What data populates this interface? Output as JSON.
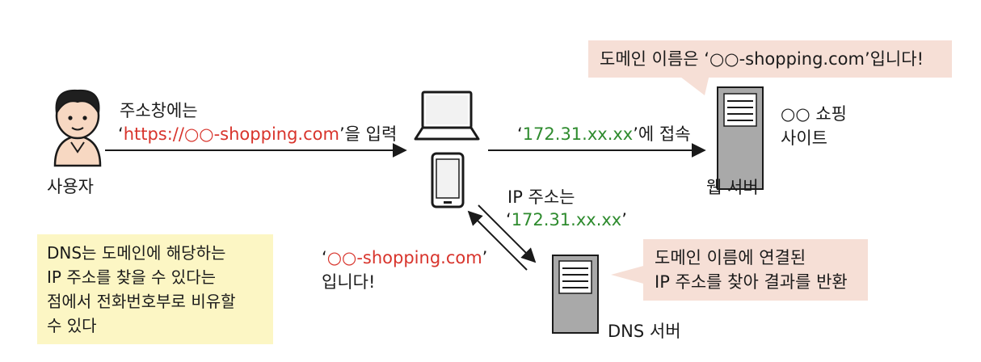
{
  "user": {
    "label": "사용자",
    "icon": "person-icon"
  },
  "request": {
    "line1": "주소창에는",
    "quote_open": "‘",
    "url": "https://○○-shopping.com",
    "quote_close": "’을 입력"
  },
  "devices": {
    "laptop_icon": "laptop-icon",
    "phone_icon": "smartphone-icon"
  },
  "connect": {
    "quote_open": "‘",
    "ip": "172.31.xx.xx",
    "quote_close": "’에 접속"
  },
  "web_server": {
    "label": "웹 서버",
    "site_line1": "○○ 쇼핑",
    "site_line2": "사이트",
    "bubble_prefix": "도메인 이름은 ‘",
    "bubble_domain": "○○-shopping.com",
    "bubble_suffix": "’입니다!",
    "icon": "server-icon"
  },
  "dns_reply": {
    "line1": "IP 주소는",
    "quote_open": "‘",
    "ip": "172.31.xx.xx",
    "quote_close": "’"
  },
  "dns_query": {
    "quote_open": "‘",
    "domain": "○○-shopping.com",
    "quote_close": "’",
    "line2": "입니다!"
  },
  "dns_server": {
    "label": "DNS 서버",
    "bubble_line1": "도메인 이름에 연결된",
    "bubble_line2": "IP 주소를 찾아 결과를 반환",
    "icon": "server-icon"
  },
  "note": {
    "line1": "DNS는 도메인에 해당하는",
    "line2": "IP 주소를 찾을 수 있다는",
    "line3": "점에서 전화번호부로 비유할",
    "line4": "수 있다"
  },
  "colors": {
    "highlight_red": "#d8342c",
    "highlight_green": "#2e8b2e",
    "bubble_bg": "#f6dfd6",
    "note_bg": "#fcf6c4",
    "server_gray": "#a9a9a9"
  }
}
